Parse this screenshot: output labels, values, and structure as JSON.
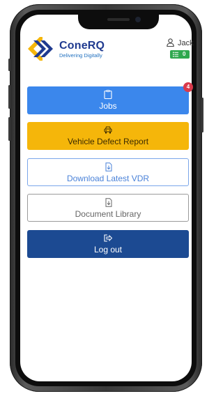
{
  "brand": {
    "name": "ConeRQ",
    "tagline": "Delivering Digitally",
    "colors": {
      "primary": "#1f3a8f",
      "accent": "#f5b60a"
    }
  },
  "user": {
    "name": "Jack",
    "badge_count": "0",
    "badge_color": "#2fa84f",
    "icon": "user-icon"
  },
  "menu": {
    "jobs": {
      "label": "Jobs",
      "icon": "clipboard-icon",
      "notification": "4",
      "color": "#3b87ec"
    },
    "vdr": {
      "label": "Vehicle Defect Report",
      "icon": "car-icon",
      "color": "#f5b60a"
    },
    "download": {
      "label": "Download Latest VDR",
      "icon": "file-download-icon"
    },
    "library": {
      "label": "Document Library",
      "icon": "file-download-icon"
    },
    "logout": {
      "label": "Log out",
      "icon": "logout-icon",
      "color": "#1c4a92"
    }
  }
}
